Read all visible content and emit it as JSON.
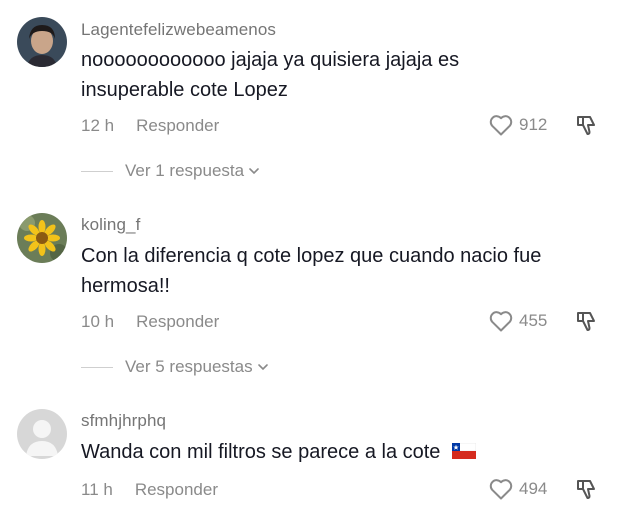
{
  "comments": [
    {
      "username": "Lagentefelizwebeamenos",
      "text_line1": "noooooooooooo jajaja ya quisiera jajaja es",
      "text_line2": "insuperable cote Lopez",
      "time": "12 h",
      "reply_label": "Responder",
      "likes": "912",
      "view_replies": "Ver 1 respuesta"
    },
    {
      "username": "koling_f",
      "text_line1": "Con la diferencia q cote lopez que cuando nacio fue",
      "text_line2": "hermosa!!",
      "time": "10 h",
      "reply_label": "Responder",
      "likes": "455",
      "view_replies": "Ver 5 respuestas"
    },
    {
      "username": "sfmhjhrphq",
      "text_line1": "Wanda con mil filtros se parece a la cote",
      "time": "11 h",
      "reply_label": "Responder",
      "likes": "494"
    }
  ],
  "icons": {
    "like": "heart-outline-icon",
    "dislike": "thumbs-down-icon",
    "expand": "chevron-down-icon",
    "flag": "chile-flag-icon"
  },
  "colors": {
    "text": "#161823",
    "secondary": "#8a8a8a",
    "username": "#757575"
  }
}
